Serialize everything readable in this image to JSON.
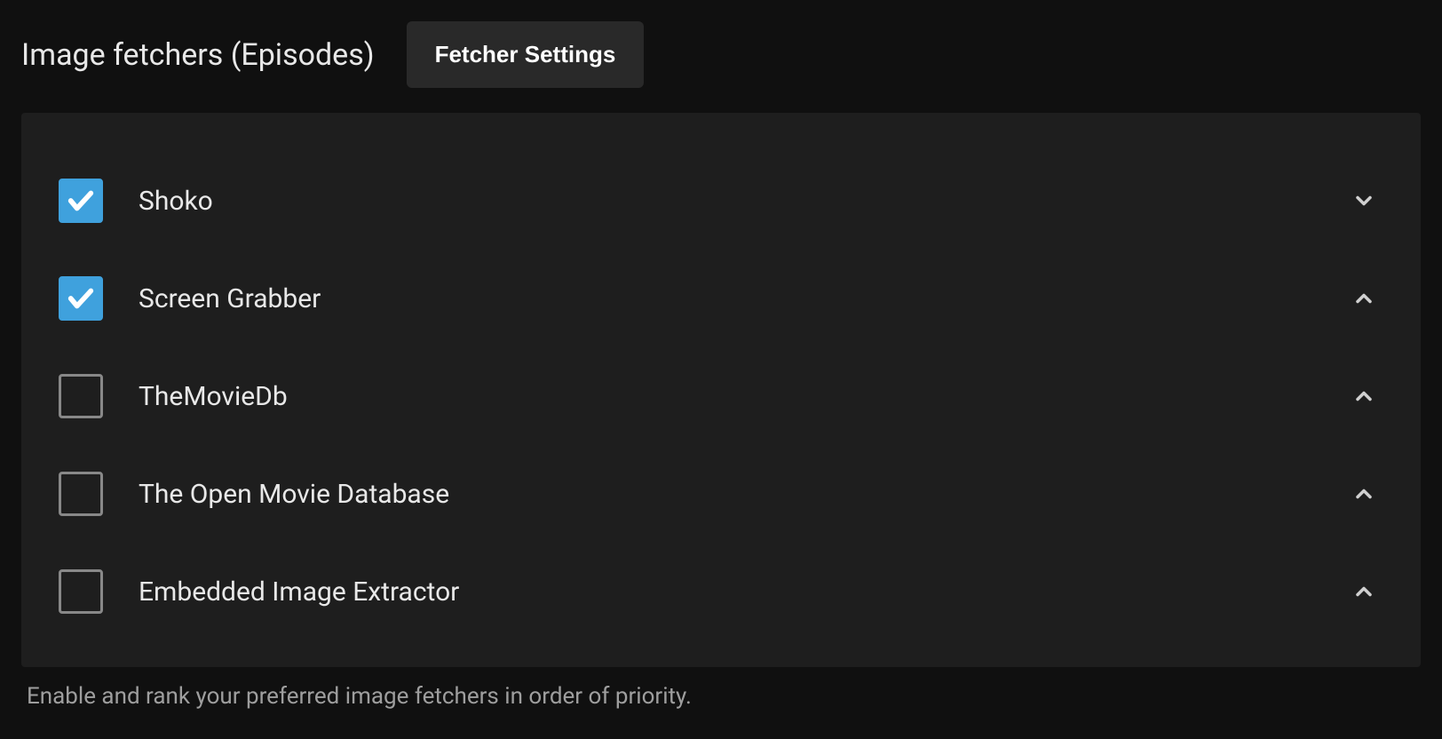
{
  "section_title": "Image fetchers (Episodes)",
  "fetcher_settings_button": "Fetcher Settings",
  "fetchers": [
    {
      "label": "Shoko",
      "checked": true,
      "direction": "down"
    },
    {
      "label": "Screen Grabber",
      "checked": true,
      "direction": "up"
    },
    {
      "label": "TheMovieDb",
      "checked": false,
      "direction": "up"
    },
    {
      "label": "The Open Movie Database",
      "checked": false,
      "direction": "up"
    },
    {
      "label": "Embedded Image Extractor",
      "checked": false,
      "direction": "up"
    }
  ],
  "help_text": "Enable and rank your preferred image fetchers in order of priority."
}
